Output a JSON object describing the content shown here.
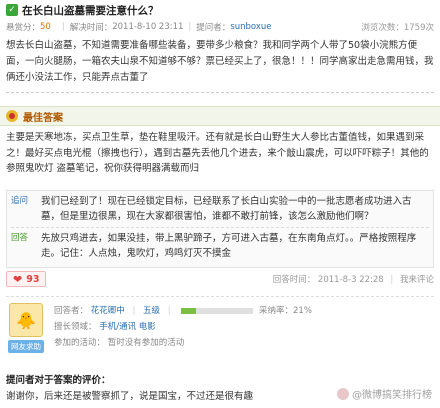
{
  "question": {
    "title": "在长白山盗墓需要注意什么？",
    "reward_label": "悬赏分：",
    "reward_value": "50",
    "solved_label": "解决时间：",
    "solved_time": "2011-8-10 23:11",
    "asker_label": "提问者：",
    "asker_name": "sunboxue",
    "views": "浏览次数：1759次",
    "body_a": "想去长白山盗墓，不知道需要准备哪些装备，要带多少粮食？我和同学两个人带了50袋小浣熊方便面，一向火腿肠，一箱农夫山泉不知道够不够？票已经买上了，很急！！！同学高家出走急需用钱，我俩还小没法工作，只能弄点古董了"
  },
  "best": {
    "header": "最佳答案",
    "body": "主要是天寒地冻，买点卫生草，垫在鞋里吸汗。还有就是长白山野生大人参比古董值钱，如果遇到采之！最好买点电光棍（擦拽也行），遇到古墓先丢他几个进去，来个敲山震虎，可以吓吓粽子！其他的参照鬼吹灯 盗墓笔记，祝你获得明器满载而归"
  },
  "followup": [
    {
      "tag": "追问",
      "text": "我们已经到了！现在已经锁定目标，已经联系了长白山实验一中的一批志愿者成功进入古墓，但是里边很黑，现在大家都很害怕，谁都不敢打前锋，该怎么激励他们啊？"
    },
    {
      "tag": "回答",
      "text": "先放只鸡进去，如果没挂，带上黑驴蹄子，方可进入古墓，在东南角点灯。。严格按照程序走。记住：人点烛，鬼吹灯，鸡鸣灯灭不摸金"
    }
  ],
  "vote": {
    "count": "93",
    "answer_time_label": "回答时间：",
    "answer_time": "2011-8-3 22:28",
    "report_label": "我来评论"
  },
  "user": {
    "avatar_badge": "网友求助",
    "responder_label": "回答者：",
    "responder_name": "花花卿中",
    "level": "五级",
    "adoption": "采纳率：21%",
    "adoption_rate": 0.21,
    "field_label": "擅长领域：",
    "fields": "手机/通讯  电影",
    "activity_label": "参加的活动：",
    "activity": "暂时没有参加的活动"
  },
  "evaluation": {
    "title": "提问者对于答案的评价：",
    "text": "谢谢你，后来还是被警察抓了，说是国宝，不过还是很有趣"
  },
  "watermark": "@微博搞笑排行榜"
}
